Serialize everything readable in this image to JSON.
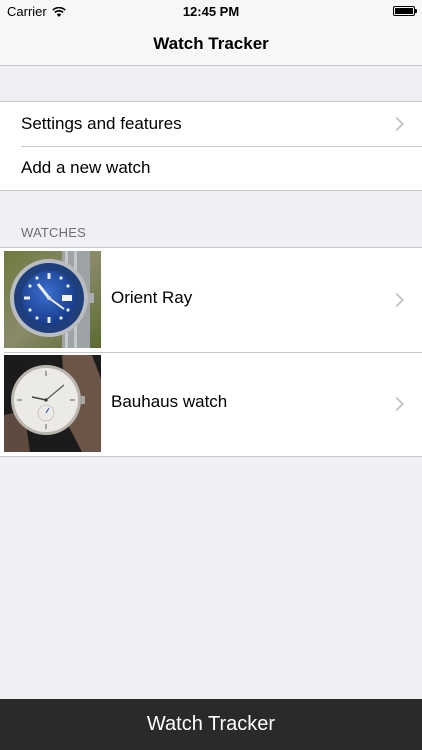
{
  "status_bar": {
    "carrier": "Carrier",
    "time": "12:45 PM",
    "battery_level": 1.0
  },
  "nav": {
    "title": "Watch Tracker"
  },
  "menu": {
    "items": [
      {
        "label": "Settings and features",
        "icon": "chevron-right-icon"
      },
      {
        "label": "Add a new watch"
      }
    ]
  },
  "watches": {
    "header": "WATCHES",
    "items": [
      {
        "label": "Orient Ray",
        "icon": "chevron-right-icon"
      },
      {
        "label": "Bauhaus watch",
        "icon": "chevron-right-icon"
      }
    ]
  },
  "footer": {
    "title": "Watch Tracker"
  },
  "colors": {
    "background": "#efeff4",
    "bar": "#f7f7f7",
    "separator": "#c8c7cc",
    "chevron": "#c7c7cc",
    "footer": "#2a2a2a",
    "header_text": "#6d6d72"
  }
}
